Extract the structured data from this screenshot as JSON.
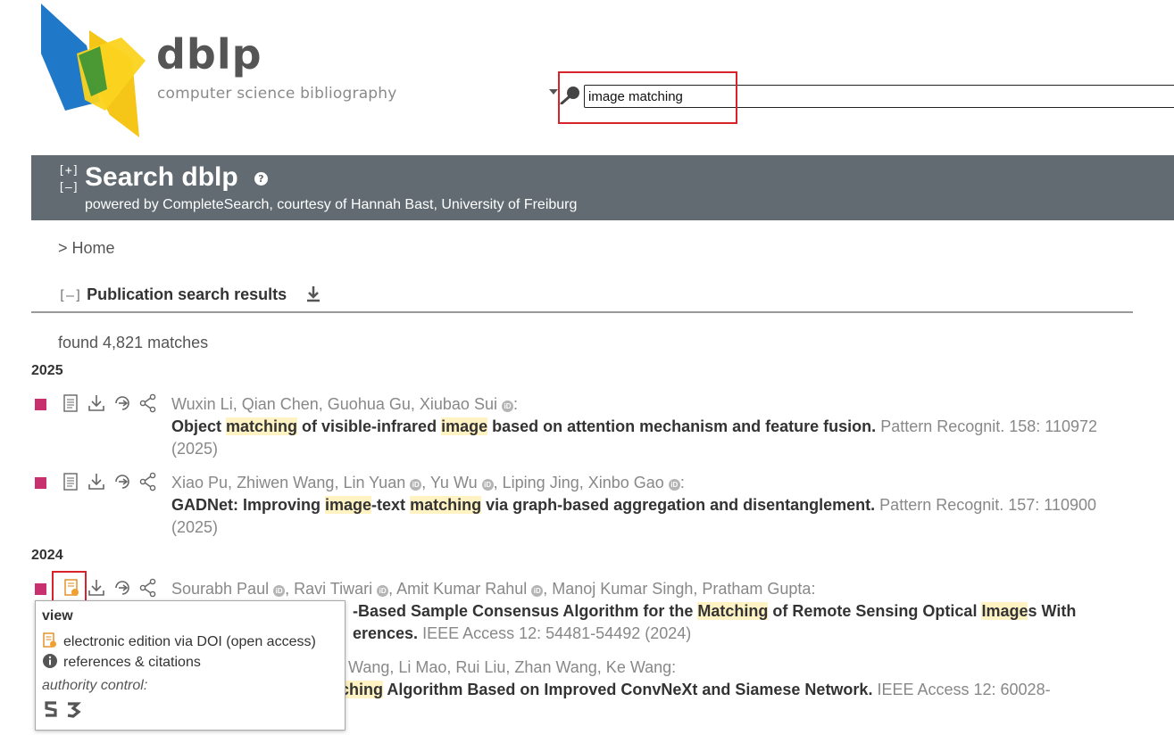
{
  "logo": {
    "name": "dblp",
    "tagline": "computer science bibliography"
  },
  "search": {
    "value": "image matching"
  },
  "banner": {
    "toggle_expand": "[+]",
    "toggle_collapse": "[–]",
    "title": "Search dblp",
    "help_glyph": "?",
    "powered_prefix": "powered by ",
    "powered_link": "CompleteSearch",
    "courtesy_prefix": ", courtesy of ",
    "courtesy_person": "Hannah Bast",
    "courtesy_sep": ", ",
    "courtesy_org": "University of Freiburg"
  },
  "breadcrumb": {
    "label": "> Home"
  },
  "results": {
    "toggle": "[–]",
    "heading": "Publication search results",
    "found": "found 4,821 matches"
  },
  "years": [
    "2025",
    "2024"
  ],
  "entries": [
    {
      "authors": [
        {
          "name": "Wuxin Li"
        },
        {
          "name": "Qian Chen"
        },
        {
          "name": "Guohua Gu"
        },
        {
          "name": "Xiubao Sui",
          "orcid": true
        }
      ],
      "title_parts": [
        {
          "t": "Object "
        },
        {
          "t": "matching",
          "hl": true
        },
        {
          "t": " of visible-infrared "
        },
        {
          "t": "image",
          "hl": true
        },
        {
          "t": " based on attention mechanism and feature fusion."
        }
      ],
      "venue": " Pattern Recognit. 158: 110972 (2025)"
    },
    {
      "authors": [
        {
          "name": "Xiao Pu"
        },
        {
          "name": "Zhiwen Wang"
        },
        {
          "name": "Lin Yuan",
          "orcid": true
        },
        {
          "name": "Yu Wu",
          "orcid": true
        },
        {
          "name": "Liping Jing"
        },
        {
          "name": "Xinbo Gao",
          "orcid": true
        }
      ],
      "title_parts": [
        {
          "t": "GADNet: Improving "
        },
        {
          "t": "image",
          "hl": true
        },
        {
          "t": "-text "
        },
        {
          "t": "matching",
          "hl": true
        },
        {
          "t": " via graph-based aggregation and disentanglement."
        }
      ],
      "venue": " Pattern Recognit. 157: 110900 (2025)"
    },
    {
      "authors": [
        {
          "name": "Sourabh Paul",
          "orcid": true
        },
        {
          "name": "Ravi Tiwari",
          "orcid": true
        },
        {
          "name": "Amit Kumar Rahul",
          "orcid": true
        },
        {
          "name": "Manoj Kumar Singh"
        },
        {
          "name": "Pratham Gupta"
        }
      ],
      "title_parts": [
        {
          "t": "-Based Sample Consensus Algorithm for the "
        },
        {
          "t": "Matching",
          "hl": true
        },
        {
          "t": " of Remote Sensing Optical "
        },
        {
          "t": "Image",
          "hl": true
        },
        {
          "t": "s With"
        }
      ],
      "title_line2": "erences.",
      "venue_line2": " IEEE Access 12: 54481-54492 (2024)"
    },
    {
      "authors_partial": "n Wang, Li Mao, Rui Liu, Zhan Wang, Ke Wang:",
      "title_parts": [
        {
          "t": "tching",
          "hl": true
        },
        {
          "t": " Algorithm Based on Improved ConvNeXt and Siamese Network."
        }
      ],
      "venue": " IEEE Access 12: 60028-"
    }
  ],
  "popup": {
    "heading": "view",
    "items": [
      "electronic edition via DOI (open access)",
      "references & citations"
    ],
    "authority": "authority control:",
    "authority_icons": [
      "semantic-scholar-icon",
      "authority-icon"
    ]
  },
  "colors": {
    "banner": "#616b71",
    "marker": "#c8306e",
    "highlight": "#fff3c4",
    "annotation": "#d8232a"
  }
}
